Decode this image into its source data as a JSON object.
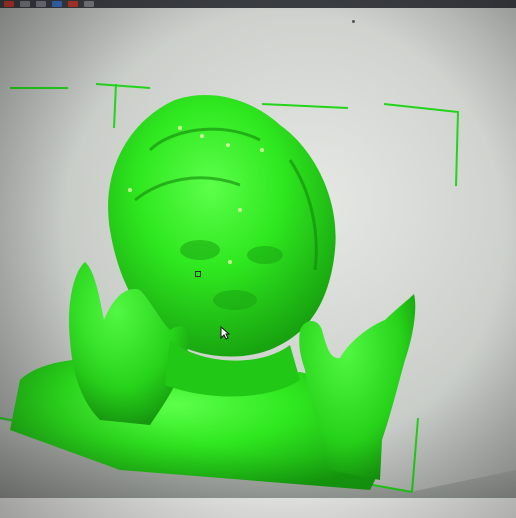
{
  "app": {
    "toolbar_items": [
      "tool",
      "tool",
      "tool",
      "tool",
      "tool",
      "tool"
    ],
    "model_color": "#2fe81f",
    "bounding_box_color": "#22d41a",
    "background_color": "#d9dcd8"
  },
  "viewport": {
    "model": "3d-scanned-figure",
    "cursor": "arrow-cursor"
  }
}
